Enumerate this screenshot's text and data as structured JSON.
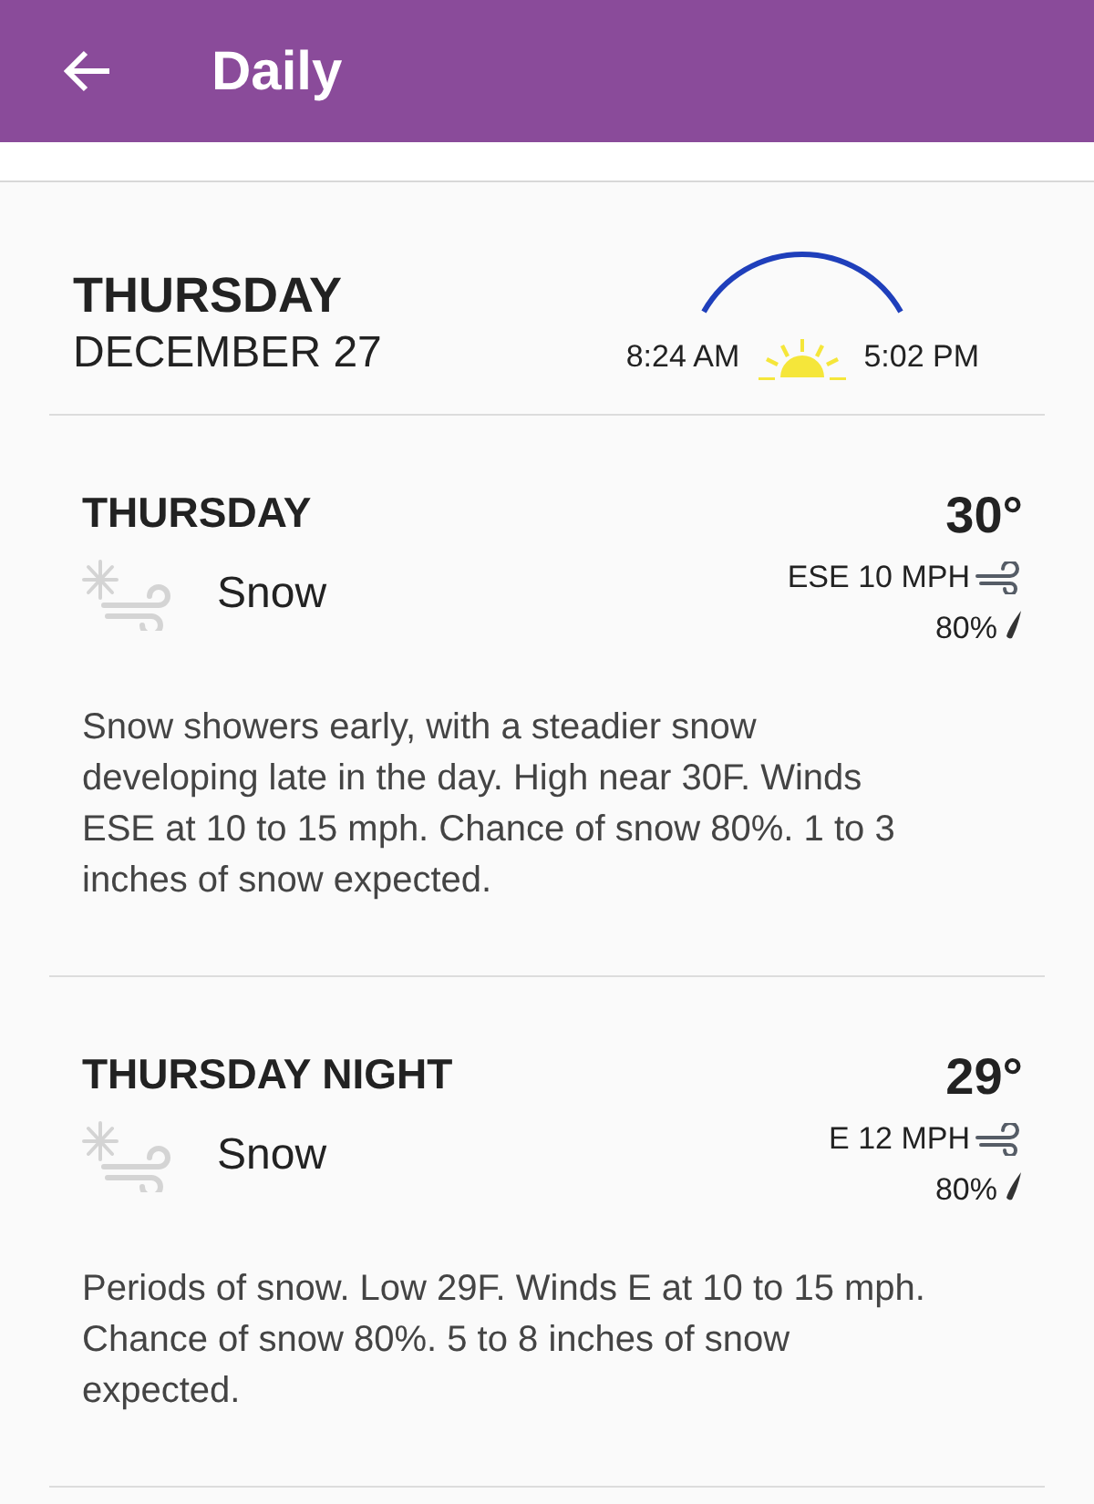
{
  "header": {
    "title": "Daily"
  },
  "summary": {
    "day": "THURSDAY",
    "date": "DECEMBER 27",
    "sunrise": "8:24 AM",
    "sunset": "5:02 PM"
  },
  "periods": [
    {
      "name": "THURSDAY",
      "condition": "Snow",
      "temperature": "30°",
      "wind": "ESE 10 MPH",
      "precip": "80%",
      "description": "Snow showers early, with a steadier snow developing late in the day. High near 30F. Winds ESE at 10 to 15 mph. Chance of snow 80%. 1 to 3 inches of snow expected."
    },
    {
      "name": "THURSDAY NIGHT",
      "condition": "Snow",
      "temperature": "29°",
      "wind": "E 12 MPH",
      "precip": "80%",
      "description": "Periods of snow. Low 29F. Winds E at 10 to 15 mph. Chance of snow 80%. 5 to 8 inches of snow expected."
    }
  ]
}
